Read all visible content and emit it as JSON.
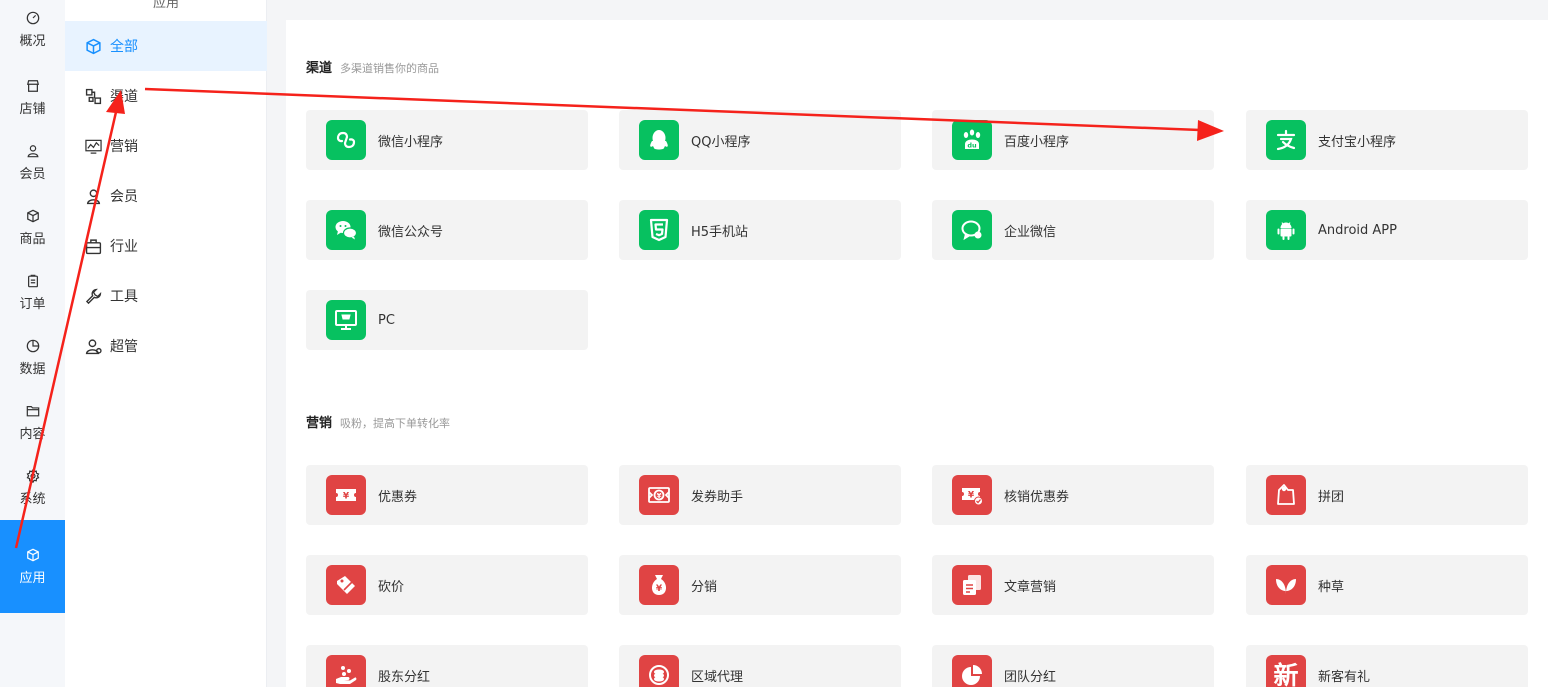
{
  "rail": {
    "items": [
      {
        "label": "概况",
        "icon": "dashboard-icon"
      },
      {
        "label": "店铺",
        "icon": "store-icon"
      },
      {
        "label": "会员",
        "icon": "user-icon"
      },
      {
        "label": "商品",
        "icon": "box-icon"
      },
      {
        "label": "订单",
        "icon": "clipboard-icon"
      },
      {
        "label": "数据",
        "icon": "pie-chart-icon"
      },
      {
        "label": "内容",
        "icon": "folder-icon"
      },
      {
        "label": "系统",
        "icon": "gear-icon"
      },
      {
        "label": "应用",
        "icon": "cube-icon"
      }
    ]
  },
  "subnav": {
    "title": "应用",
    "items": [
      {
        "label": "全部",
        "icon": "cube-icon"
      },
      {
        "label": "渠道",
        "icon": "channel-icon"
      },
      {
        "label": "营销",
        "icon": "marketing-icon"
      },
      {
        "label": "会员",
        "icon": "user-icon"
      },
      {
        "label": "行业",
        "icon": "briefcase-icon"
      },
      {
        "label": "工具",
        "icon": "wrench-icon"
      },
      {
        "label": "超管",
        "icon": "admin-icon"
      }
    ]
  },
  "channels": {
    "title": "渠道",
    "subtitle": "多渠道销售你的商品",
    "tiles": [
      {
        "label": "微信小程序",
        "icon": "wechat-miniprogram-icon"
      },
      {
        "label": "QQ小程序",
        "icon": "qq-icon"
      },
      {
        "label": "百度小程序",
        "icon": "baidu-icon"
      },
      {
        "label": "支付宝小程序",
        "icon": "alipay-icon"
      },
      {
        "label": "微信公众号",
        "icon": "wechat-icon"
      },
      {
        "label": "H5手机站",
        "icon": "html5-icon"
      },
      {
        "label": "企业微信",
        "icon": "wecom-icon"
      },
      {
        "label": "Android APP",
        "icon": "android-icon"
      },
      {
        "label": "PC",
        "icon": "monitor-icon"
      }
    ]
  },
  "marketing": {
    "title": "营销",
    "subtitle": "吸粉，提高下单转化率",
    "tiles": [
      {
        "label": "优惠券",
        "icon": "coupon-icon"
      },
      {
        "label": "发券助手",
        "icon": "coupon-assistant-icon"
      },
      {
        "label": "核销优惠券",
        "icon": "coupon-verify-icon"
      },
      {
        "label": "拼团",
        "icon": "group-buy-icon"
      },
      {
        "label": "砍价",
        "icon": "bargain-icon"
      },
      {
        "label": "分销",
        "icon": "money-bag-icon"
      },
      {
        "label": "文章营销",
        "icon": "article-icon"
      },
      {
        "label": "种草",
        "icon": "sprout-icon"
      },
      {
        "label": "股东分红",
        "icon": "dividend-icon"
      },
      {
        "label": "区域代理",
        "icon": "coins-icon"
      },
      {
        "label": "团队分红",
        "icon": "team-pie-icon"
      },
      {
        "label": "新客有礼",
        "icon": "new-customer-icon",
        "glyph": "新"
      }
    ]
  },
  "colors": {
    "accent": "#1890ff",
    "channel_icon_bg": "#07c160",
    "marketing_icon_bg": "#e04444",
    "annotation_arrow": "#f5221b"
  }
}
